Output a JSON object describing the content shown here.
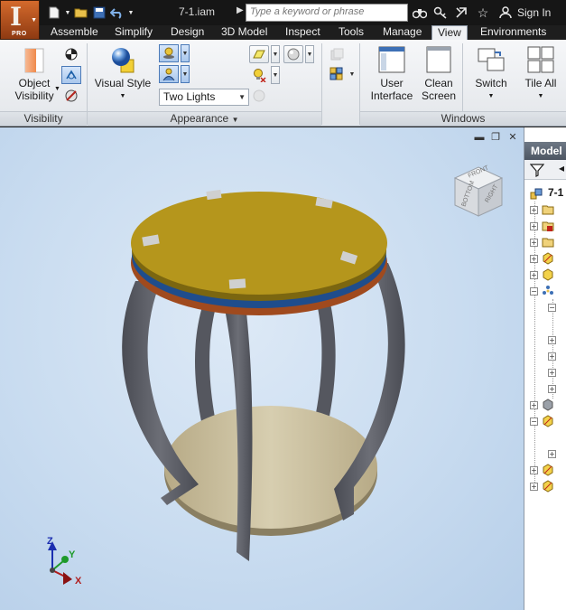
{
  "window": {
    "document_title": "7-1.iam",
    "search_placeholder": "Type a keyword or phrase",
    "sign_in_label": "Sign In",
    "app_badge": "PRO",
    "app_letter": "I"
  },
  "ribbon": {
    "tabs": [
      {
        "label": "Assemble",
        "active": false
      },
      {
        "label": "Simplify",
        "active": false
      },
      {
        "label": "Design",
        "active": false
      },
      {
        "label": "3D Model",
        "active": false
      },
      {
        "label": "Inspect",
        "active": false
      },
      {
        "label": "Tools",
        "active": false
      },
      {
        "label": "Manage",
        "active": false
      },
      {
        "label": "View",
        "active": true
      },
      {
        "label": "Environments",
        "active": false
      }
    ],
    "panels": {
      "visibility": {
        "label": "Visibility",
        "object_visibility_line1": "Object",
        "object_visibility_line2": "Visibility"
      },
      "appearance": {
        "label": "Appearance",
        "visual_style_label": "Visual Style",
        "lighting_value": "Two Lights"
      },
      "windows": {
        "label": "Windows",
        "user_interface_line1": "User",
        "user_interface_line2": "Interface",
        "clean_screen_line1": "Clean",
        "clean_screen_line2": "Screen",
        "switch_label": "Switch",
        "tile_all_label": "Tile All"
      }
    }
  },
  "viewport": {
    "viewcube_face": "FRONT",
    "viewcube_side": "RIGHT",
    "viewcube_left": "BOTTOM",
    "axes": {
      "x": "X",
      "y": "Y",
      "z": "Z"
    },
    "colors": {
      "top_disc": "#b5961c",
      "blue_ring": "#1f4d8c",
      "red_ring": "#a04a1e",
      "legs": "#5e6068",
      "shelf": "#c4b897",
      "background": "#c9dcf0"
    }
  },
  "browser": {
    "title": "Model",
    "root_label": "7-1"
  }
}
